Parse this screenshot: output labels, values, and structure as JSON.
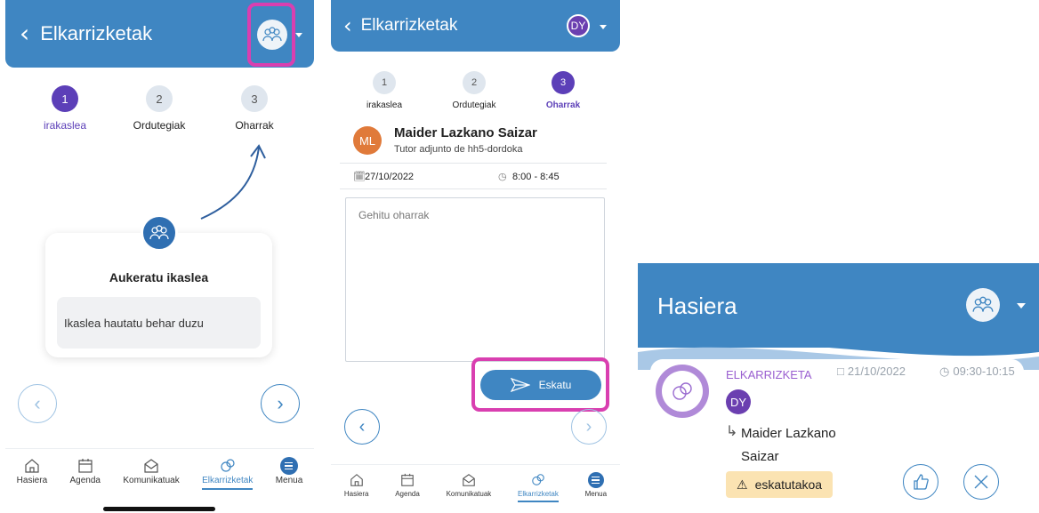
{
  "screen1": {
    "header_title": "Elkarrizketak",
    "steps": [
      {
        "number": "1",
        "label": "irakaslea"
      },
      {
        "number": "2",
        "label": "Ordutegiak"
      },
      {
        "number": "3",
        "label": "Oharrak"
      }
    ],
    "card_title": "Aukeratu ikaslea",
    "card_message": "Ikaslea hautatu behar duzu"
  },
  "screen2": {
    "header_title": "Elkarrizketak",
    "avatar_initials": "DY",
    "steps": [
      {
        "number": "1",
        "label": "irakaslea"
      },
      {
        "number": "2",
        "label": "Ordutegiak"
      },
      {
        "number": "3",
        "label": "Oharrak"
      }
    ],
    "teacher_initials": "ML",
    "teacher_name": "Maider Lazkano Saizar",
    "teacher_role": "Tutor adjunto de hh5-dordoka",
    "date": "27/10/2022",
    "time": "8:00 - 8:45",
    "notes_placeholder": "Gehitu oharrak",
    "send_label": "Eskatu"
  },
  "tabbar": [
    {
      "label": "Hasiera"
    },
    {
      "label": "Agenda"
    },
    {
      "label": "Komunikatuak"
    },
    {
      "label": "Elkarrizketak"
    },
    {
      "label": "Menua"
    }
  ],
  "screen3": {
    "header_title": "Hasiera",
    "category": "ELKARRIZKETA",
    "date": "21/10/2022",
    "time": "09:30-10:15",
    "avatar_initials": "DY",
    "name_line1": "Maider Lazkano",
    "name_line2": "Saizar",
    "status": "eskatutakoa"
  },
  "colors": {
    "header_blue": "#3f86c2",
    "accent_purple": "#5c3fb8",
    "highlight_pink": "#d93fb0",
    "status_bg": "#fbe3b2",
    "teacher_avatar": "#e07a3a"
  }
}
